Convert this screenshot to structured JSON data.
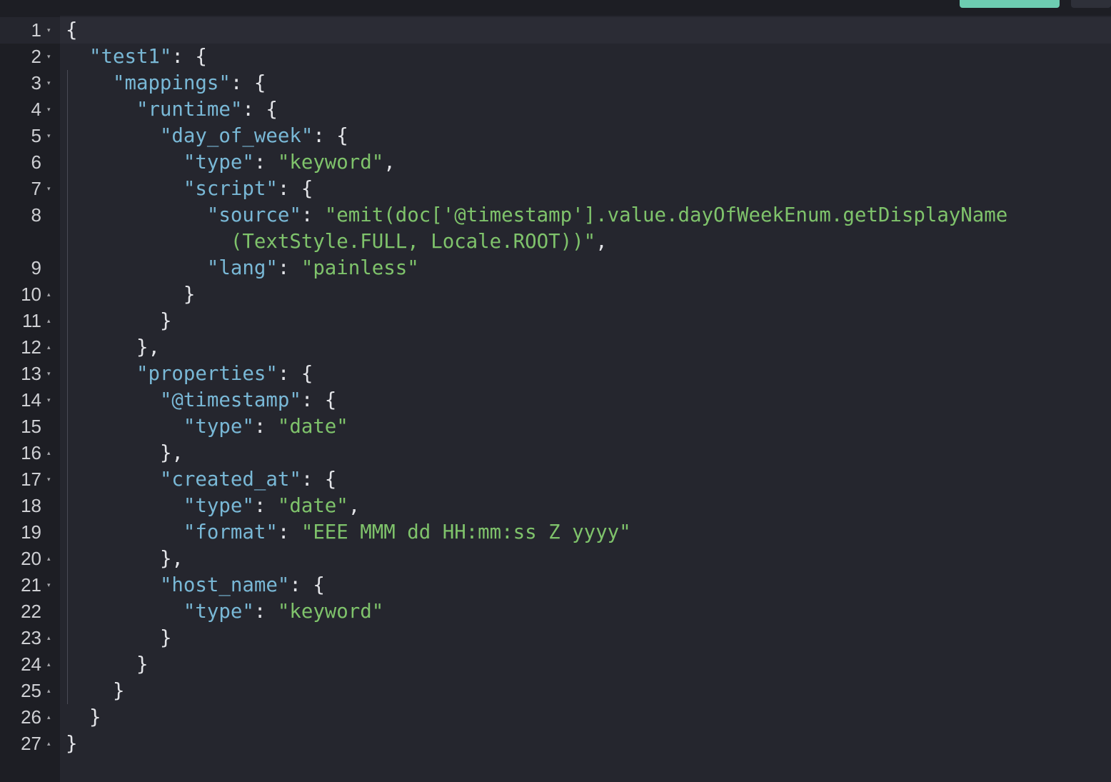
{
  "editor": {
    "line_numbers": [
      "1",
      "2",
      "3",
      "4",
      "5",
      "6",
      "7",
      "8",
      "9",
      "10",
      "11",
      "12",
      "13",
      "14",
      "15",
      "16",
      "17",
      "18",
      "19",
      "20",
      "21",
      "22",
      "23",
      "24",
      "25",
      "26",
      "27"
    ],
    "fold_markers": [
      "▾",
      "▾",
      "▾",
      "▾",
      "▾",
      "",
      "▾",
      "",
      "",
      "▴",
      "▴",
      "▴",
      "▾",
      "▾",
      "",
      "▴",
      "▾",
      "",
      "",
      "▴",
      "▾",
      "",
      "▴",
      "▴",
      "▴",
      "▴",
      "▴"
    ],
    "lines": {
      "l1": {
        "indent": "",
        "p1": "{"
      },
      "l2": {
        "indent": "  ",
        "key": "\"test1\"",
        "p1": ": {"
      },
      "l3": {
        "indent": "    ",
        "key": "\"mappings\"",
        "p1": ": {"
      },
      "l4": {
        "indent": "      ",
        "key": "\"runtime\"",
        "p1": ": {"
      },
      "l5": {
        "indent": "        ",
        "key": "\"day_of_week\"",
        "p1": ": {"
      },
      "l6": {
        "indent": "          ",
        "key": "\"type\"",
        "p1": ": ",
        "val": "\"keyword\"",
        "p2": ","
      },
      "l7": {
        "indent": "          ",
        "key": "\"script\"",
        "p1": ": {"
      },
      "l8": {
        "indent": "            ",
        "key": "\"source\"",
        "p1": ": ",
        "val": "\"emit(doc['@timestamp'].value.dayOfWeekEnum.getDisplayName",
        "cont_indent": "              ",
        "cont_val": "(TextStyle.FULL, Locale.ROOT))\"",
        "p2": ","
      },
      "l9": {
        "indent": "            ",
        "key": "\"lang\"",
        "p1": ": ",
        "val": "\"painless\""
      },
      "l10": {
        "indent": "          ",
        "p1": "}"
      },
      "l11": {
        "indent": "        ",
        "p1": "}"
      },
      "l12": {
        "indent": "      ",
        "p1": "},"
      },
      "l13": {
        "indent": "      ",
        "key": "\"properties\"",
        "p1": ": {"
      },
      "l14": {
        "indent": "        ",
        "key": "\"@timestamp\"",
        "p1": ": {"
      },
      "l15": {
        "indent": "          ",
        "key": "\"type\"",
        "p1": ": ",
        "val": "\"date\""
      },
      "l16": {
        "indent": "        ",
        "p1": "},"
      },
      "l17": {
        "indent": "        ",
        "key": "\"created_at\"",
        "p1": ": {"
      },
      "l18": {
        "indent": "          ",
        "key": "\"type\"",
        "p1": ": ",
        "val": "\"date\"",
        "p2": ","
      },
      "l19": {
        "indent": "          ",
        "key": "\"format\"",
        "p1": ": ",
        "val": "\"EEE MMM dd HH:mm:ss Z yyyy\""
      },
      "l20": {
        "indent": "        ",
        "p1": "},"
      },
      "l21": {
        "indent": "        ",
        "key": "\"host_name\"",
        "p1": ": {"
      },
      "l22": {
        "indent": "          ",
        "key": "\"type\"",
        "p1": ": ",
        "val": "\"keyword\""
      },
      "l23": {
        "indent": "        ",
        "p1": "}"
      },
      "l24": {
        "indent": "      ",
        "p1": "}"
      },
      "l25": {
        "indent": "    ",
        "p1": "}"
      },
      "l26": {
        "indent": "  ",
        "p1": "}"
      },
      "l27": {
        "indent": "",
        "p1": "}"
      }
    },
    "colors": {
      "background": "#25262e",
      "gutter": "#1d1e24",
      "key": "#79b8d6",
      "string": "#7fc36b",
      "punctuation": "#e3e4e8",
      "accent_button": "#6dccb1"
    }
  }
}
